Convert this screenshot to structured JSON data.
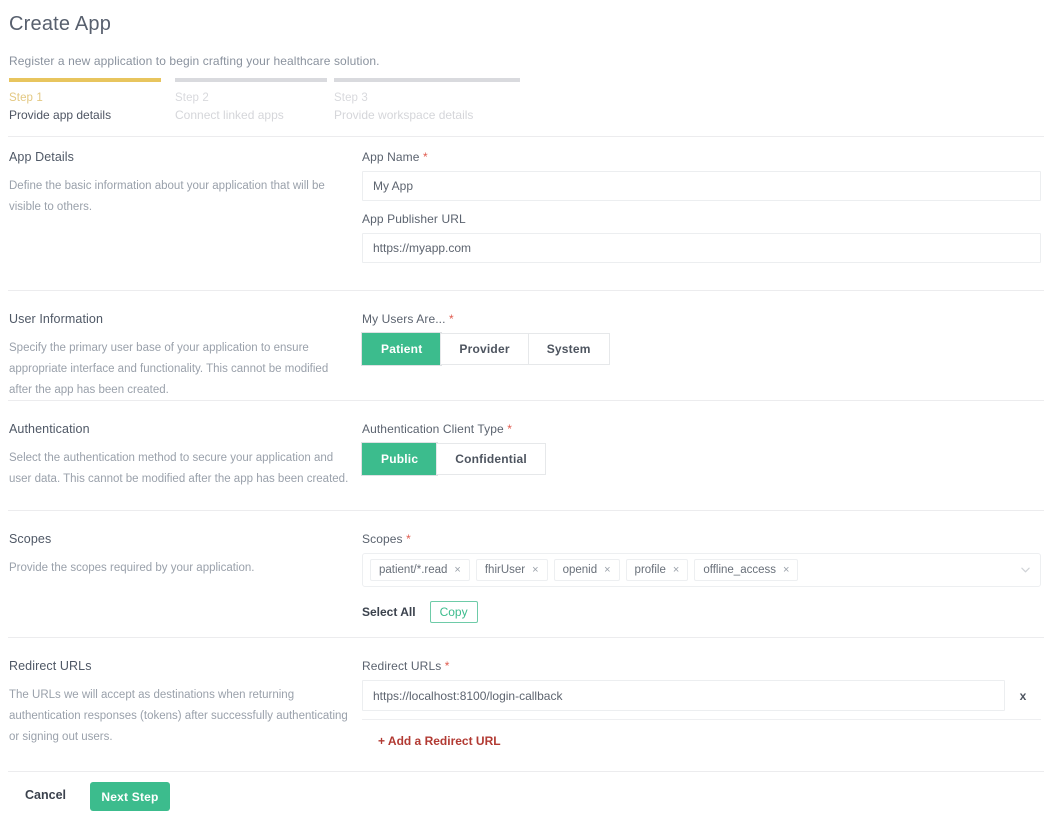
{
  "header": {
    "title": "Create App",
    "subtitle": "Register a new application to begin crafting your healthcare solution."
  },
  "stepper": {
    "steps": [
      {
        "num": "Step 1",
        "label": "Provide app details"
      },
      {
        "num": "Step 2",
        "label": "Connect linked apps"
      },
      {
        "num": "Step 3",
        "label": "Provide workspace details"
      }
    ]
  },
  "sections": {
    "app_details": {
      "title": "App Details",
      "desc": "Define the basic information about your application that will be visible to others.",
      "app_name": {
        "label": "App Name",
        "required": "*",
        "value": "My App",
        "placeholder": "My App"
      },
      "publisher_url": {
        "label": "App Publisher URL",
        "required": "",
        "value": "https://myapp.com",
        "placeholder": "https://myapp.com"
      }
    },
    "user_information": {
      "title": "User Information",
      "desc": "Specify the primary user base of your application to ensure appropriate interface and functionality. This cannot be modified after the app has been created.",
      "users_label": "My Users Are...",
      "required": "*",
      "options": [
        "Patient",
        "Provider",
        "System"
      ],
      "selected": "Patient"
    },
    "authentication": {
      "title": "Authentication",
      "desc": "Select the authentication method to secure your application and user data. This cannot be modified after the app has been created.",
      "client_type_label": "Authentication Client Type",
      "required": "*",
      "options": [
        "Public",
        "Confidential"
      ],
      "selected": "Public"
    },
    "scopes": {
      "title": "Scopes",
      "desc": "Provide the scopes required by your application.",
      "field_label": "Scopes",
      "required": "*",
      "chips": [
        "patient/*.read",
        "fhirUser",
        "openid",
        "profile",
        "offline_access"
      ],
      "chip_remove_glyph": "×",
      "dropdown_icon": "chevron-down-icon",
      "select_all_label": "Select All",
      "copy_label": "Copy"
    },
    "redirect_urls": {
      "title": "Redirect URLs",
      "desc": "The URLs we will accept as destinations when returning authentication responses (tokens) after successfully authenticating or signing out users.",
      "field_label": "Redirect URLs",
      "required": "*",
      "value": "https://localhost:8100/login-callback",
      "placeholder": "https://localhost:8100/login-callback",
      "remove_glyph": "x",
      "add_label": "+ Add a Redirect URL"
    }
  },
  "footer": {
    "cancel_label": "Cancel",
    "next_label": "Next Step"
  },
  "colors": {
    "accent_green": "#3cbc8d",
    "step_active": "#e8c55e",
    "required_red": "#e05c4f",
    "link_red": "#b23a33"
  }
}
